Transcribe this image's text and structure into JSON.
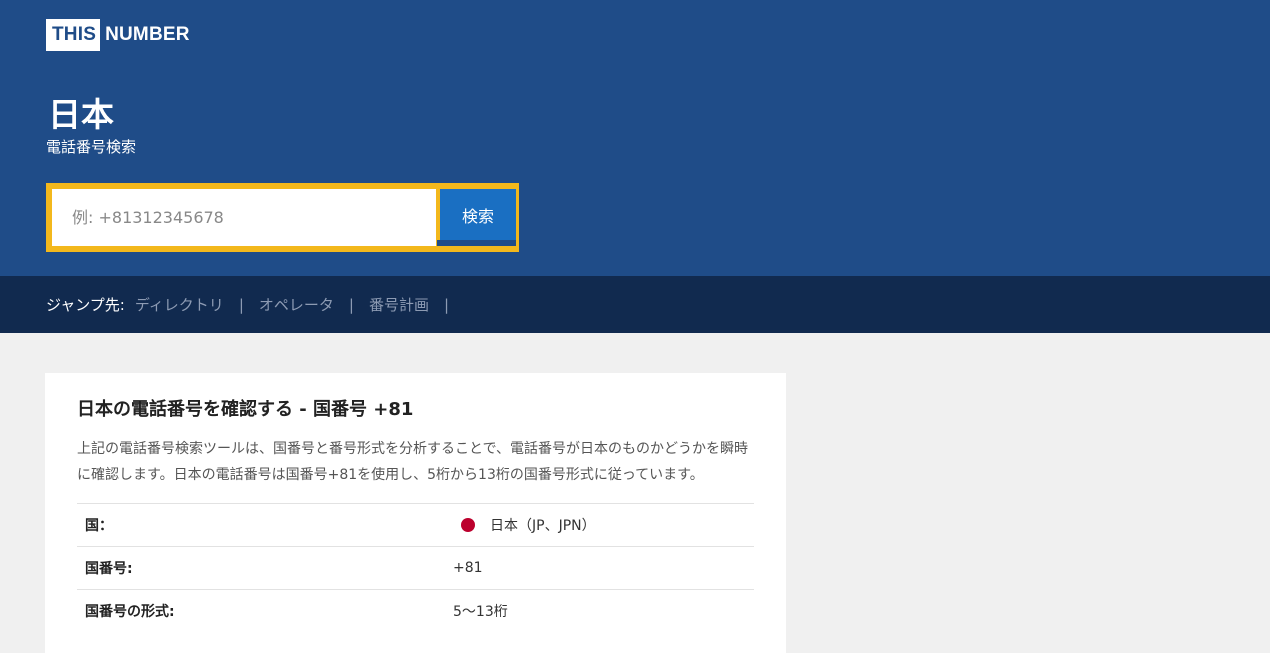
{
  "brand": {
    "part1": "THIS",
    "part2": "NUMBER"
  },
  "hero": {
    "title": "日本",
    "subtitle": "電話番号検索"
  },
  "search": {
    "placeholder": "例: +81312345678",
    "value": "",
    "button_label": "検索"
  },
  "jumpbar": {
    "label": "ジャンプ先:",
    "links": [
      "ディレクトリ",
      "オペレータ",
      "番号計画"
    ],
    "separator": "|"
  },
  "card": {
    "heading": "日本の電話番号を確認する - 国番号 +81",
    "paragraph": "上記の電話番号検索ツールは、国番号と番号形式を分析することで、電話番号が日本のものかどうかを瞬時に確認します。日本の電話番号は国番号+81を使用し、5桁から13桁の国番号形式に従っています。",
    "rows": [
      {
        "key": "国：",
        "value": "日本（JP、JPN）",
        "icon": "japan-flag-icon"
      },
      {
        "key": "国番号:",
        "value": "+81"
      },
      {
        "key": "国番号の形式:",
        "value": "5～13桁"
      }
    ]
  },
  "colors": {
    "hero_bg": "#1f4c88",
    "jumpbar_bg": "#112a4f",
    "search_border": "#f3b81c",
    "button_bg": "#1a6fc2",
    "flag_red": "#bc002d"
  }
}
